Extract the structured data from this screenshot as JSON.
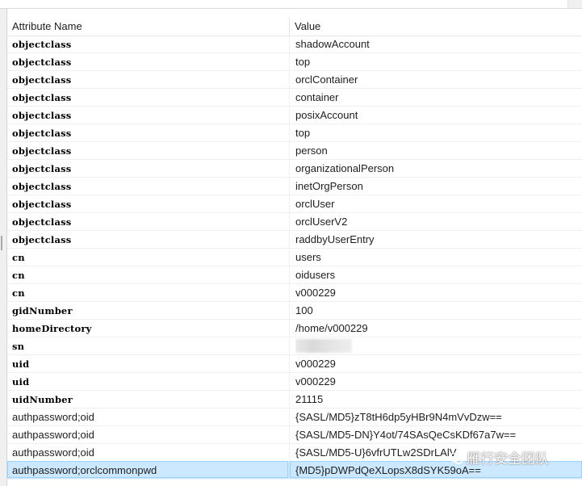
{
  "columns": {
    "name": "Attribute Name",
    "value": "Value"
  },
  "rows": [
    {
      "name": "objectclass",
      "value": "shadowAccount",
      "style": "bold"
    },
    {
      "name": "objectclass",
      "value": "top",
      "style": "bold"
    },
    {
      "name": "objectclass",
      "value": "orclContainer",
      "style": "bold"
    },
    {
      "name": "objectclass",
      "value": "container",
      "style": "bold"
    },
    {
      "name": "objectclass",
      "value": "posixAccount",
      "style": "bold"
    },
    {
      "name": "objectclass",
      "value": "top",
      "style": "bold"
    },
    {
      "name": "objectclass",
      "value": "person",
      "style": "bold"
    },
    {
      "name": "objectclass",
      "value": "organizationalPerson",
      "style": "bold"
    },
    {
      "name": "objectclass",
      "value": "inetOrgPerson",
      "style": "bold"
    },
    {
      "name": "objectclass",
      "value": "orclUser",
      "style": "bold"
    },
    {
      "name": "objectclass",
      "value": "orclUserV2",
      "style": "bold"
    },
    {
      "name": "objectclass",
      "value": "raddbyUserEntry",
      "style": "bold"
    },
    {
      "name": "cn",
      "value": "users",
      "style": "bold"
    },
    {
      "name": "cn",
      "value": "oidusers",
      "style": "bold"
    },
    {
      "name": "cn",
      "value": "v000229",
      "style": "bold"
    },
    {
      "name": "gidNumber",
      "value": "100",
      "style": "bold"
    },
    {
      "name": "homeDirectory",
      "value": "/home/v000229",
      "style": "bold"
    },
    {
      "name": "sn",
      "value": "",
      "style": "bold",
      "redacted": true
    },
    {
      "name": "uid",
      "value": "v000229",
      "style": "bold"
    },
    {
      "name": "uid",
      "value": "v000229",
      "style": "bold"
    },
    {
      "name": "uidNumber",
      "value": "21115",
      "style": "bold"
    },
    {
      "name": "authpassword;oid",
      "value": "{SASL/MD5}zT8tH6dp5yHBr9N4mVvDzw==",
      "style": "plain"
    },
    {
      "name": "authpassword;oid",
      "value": "{SASL/MD5-DN}Y4ot/74SAsQeCsKDf67a7w==",
      "style": "plain"
    },
    {
      "name": "authpassword;oid",
      "value": "{SASL/MD5-U}6vfrUTLw2SDrLAlV",
      "style": "plain"
    },
    {
      "name": "authpassword;orclcommonpwd",
      "value": "{MD5}pDWPdQeXLopsX8dSYK59oA==",
      "style": "plain",
      "selected": true
    }
  ],
  "watermark": {
    "text": "雁行安全团队"
  }
}
